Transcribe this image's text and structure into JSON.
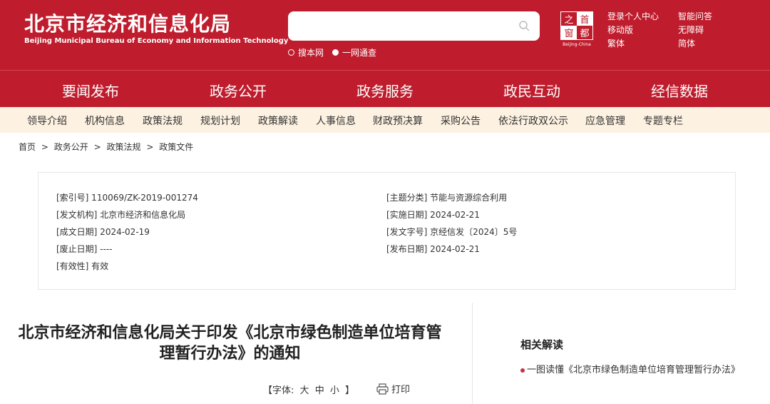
{
  "header": {
    "logo_cn": "北京市经济和信息化局",
    "logo_en": "Beijing Municipal Bureau of Economy and Information Technology",
    "search_placeholder": "",
    "radio_options": [
      "搜本网",
      "一网通查"
    ],
    "seal": {
      "c1": "首",
      "c2": "之",
      "c3": "都",
      "c4": "窗",
      "caption": "Beijing-China"
    },
    "top_links": [
      "登录个人中心",
      "智能问答",
      "移动版",
      "无障碍",
      "繁体",
      "简体"
    ]
  },
  "main_nav": [
    "要闻发布",
    "政务公开",
    "政务服务",
    "政民互动",
    "经信数据"
  ],
  "sub_nav": [
    "领导介绍",
    "机构信息",
    "政策法规",
    "规划计划",
    "政策解读",
    "人事信息",
    "财政预决算",
    "采购公告",
    "依法行政双公示",
    "应急管理",
    "专题专栏"
  ],
  "breadcrumb": [
    "首页",
    ">",
    "政务公开",
    ">",
    "政策法规",
    ">",
    "政策文件"
  ],
  "info": {
    "index_no": "[索引号] 110069/ZK-2019-001274",
    "issuer": "[发文机构] 北京市经济和信息化局",
    "created": "[成文日期] 2024-02-19",
    "abolished": "[废止日期] ----",
    "validity": "[有效性] 有效",
    "topic": "[主题分类] 节能与资源综合利用",
    "effective": "[实施日期] 2024-02-21",
    "doc_no": "[发文字号] 京经信发〔2024〕5号",
    "published": "[发布日期] 2024-02-21"
  },
  "doc_title": "北京市经济和信息化局关于印发《北京市绿色制造单位培育管理暂行办法》的通知",
  "font_ctrl": {
    "label": "【字体:",
    "big": "大",
    "mid": "中",
    "small": "小",
    "close": "】"
  },
  "print_label": "打印",
  "related": {
    "title": "相关解读",
    "item": "一图读懂《北京市绿色制造单位培育管理暂行办法》"
  }
}
